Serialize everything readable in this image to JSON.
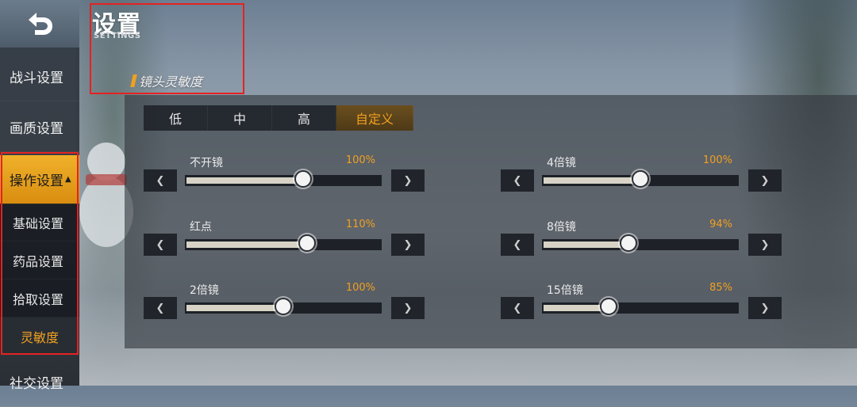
{
  "header": {
    "title": "设置",
    "subtitle": "SETTINGS",
    "section": "镜头灵敏度"
  },
  "sidebar": {
    "items": [
      {
        "label": "战斗设置"
      },
      {
        "label": "画质设置"
      },
      {
        "label": "操作设置",
        "expanded": true
      },
      {
        "label": "社交设置"
      }
    ],
    "subitems": [
      {
        "label": "基础设置"
      },
      {
        "label": "药品设置"
      },
      {
        "label": "拾取设置"
      },
      {
        "label": "灵敏度",
        "active": true
      }
    ]
  },
  "presets": {
    "tabs": [
      "低",
      "中",
      "高",
      "自定义"
    ],
    "selected": "自定义"
  },
  "sliders": [
    {
      "label": "不开镜",
      "value_text": "100%",
      "level": 0.6
    },
    {
      "label": "红点",
      "value_text": "110%",
      "level": 0.62
    },
    {
      "label": "2倍镜",
      "value_text": "100%",
      "level": 0.5
    },
    {
      "label": "4倍镜",
      "value_text": "100%",
      "level": 0.5
    },
    {
      "label": "8倍镜",
      "value_text": "94%",
      "level": 0.44
    },
    {
      "label": "15倍镜",
      "value_text": "85%",
      "level": 0.34
    }
  ],
  "icons": {
    "back": "back-arrow-icon",
    "decrease": "chevron-left-icon",
    "increase": "chevron-right-icon"
  },
  "colors": {
    "accent": "#f0a020",
    "highlight_box": "#e52222"
  }
}
